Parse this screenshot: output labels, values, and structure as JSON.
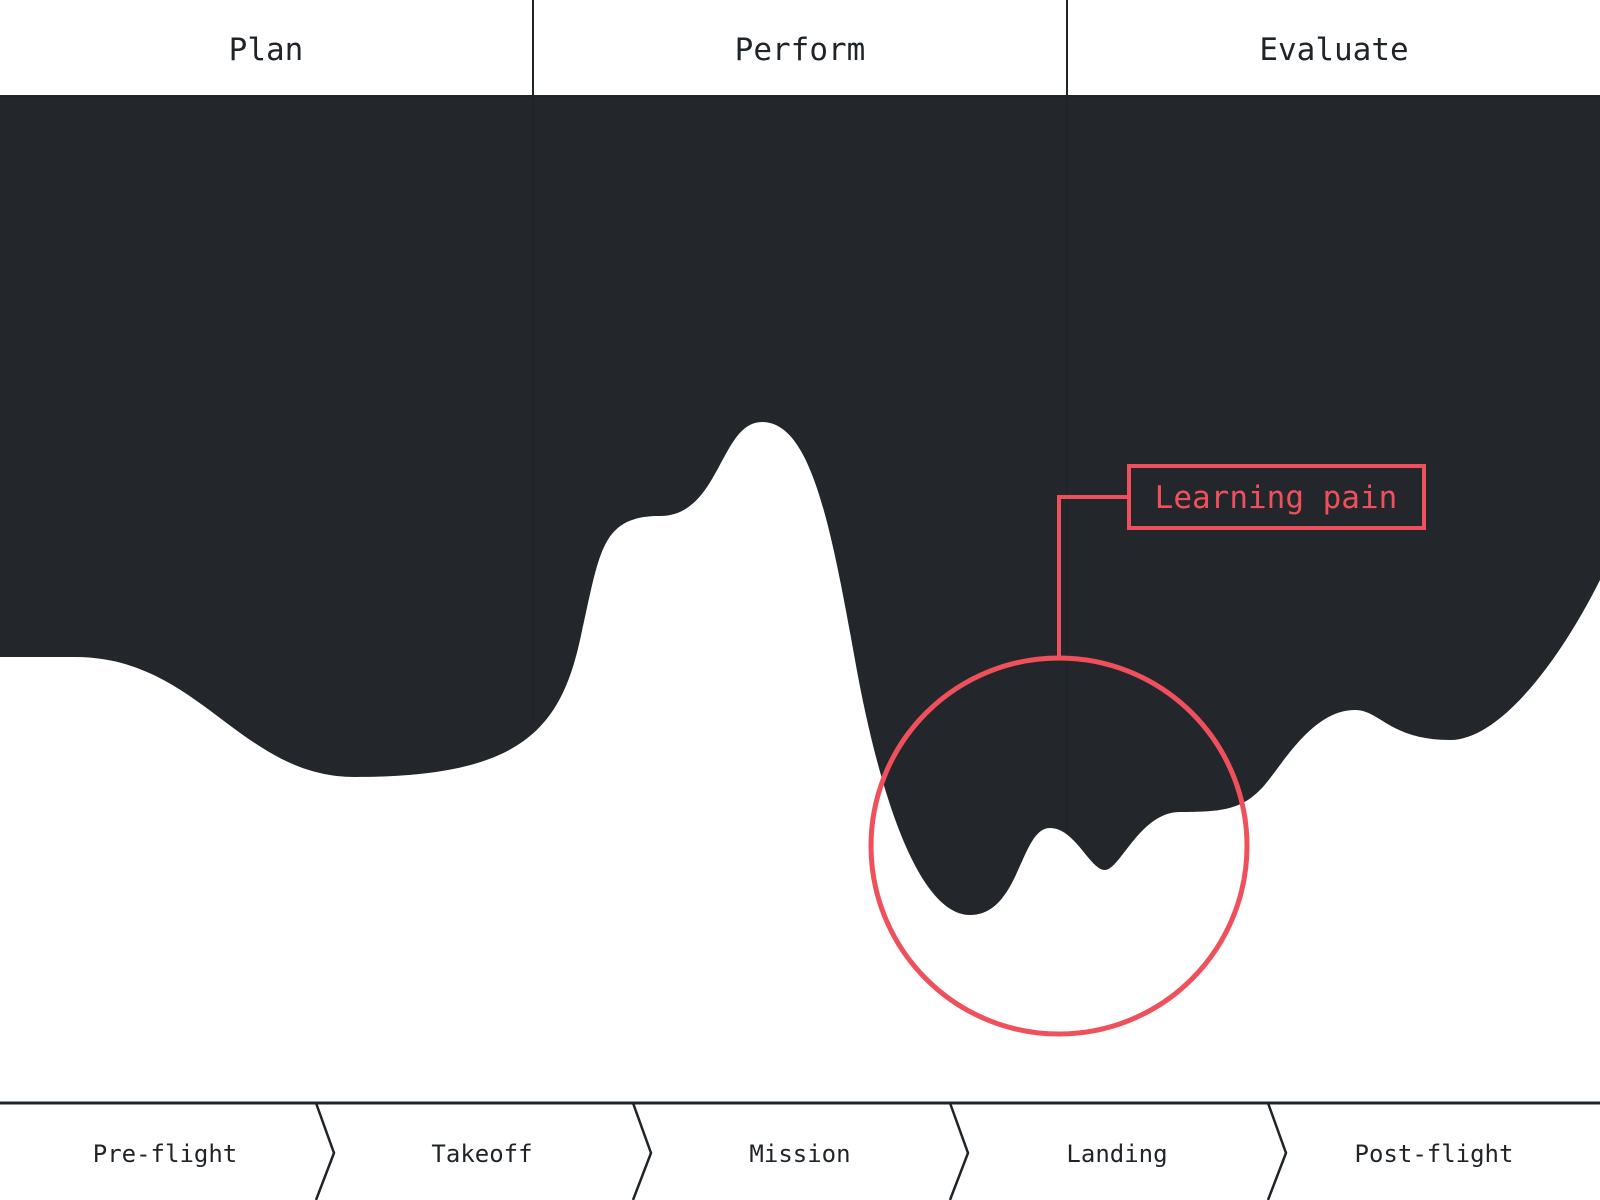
{
  "phases": [
    {
      "label": "Plan"
    },
    {
      "label": "Perform"
    },
    {
      "label": "Evaluate"
    }
  ],
  "stages": [
    {
      "label": "Pre-flight"
    },
    {
      "label": "Takeoff"
    },
    {
      "label": "Mission"
    },
    {
      "label": "Landing"
    },
    {
      "label": "Post-flight"
    }
  ],
  "callout": {
    "label": "Learning pain"
  },
  "colors": {
    "dark_area": "#23272b",
    "accent": "#f0505c",
    "line": "#1f2429",
    "background": "#ffffff"
  }
}
